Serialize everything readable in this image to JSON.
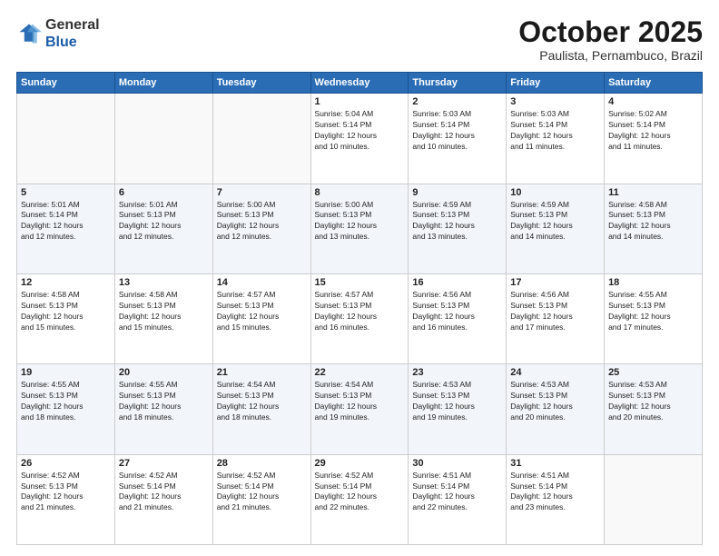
{
  "header": {
    "logo_line1": "General",
    "logo_line2": "Blue",
    "month_title": "October 2025",
    "location": "Paulista, Pernambuco, Brazil"
  },
  "weekdays": [
    "Sunday",
    "Monday",
    "Tuesday",
    "Wednesday",
    "Thursday",
    "Friday",
    "Saturday"
  ],
  "weeks": [
    [
      {
        "day": "",
        "info": ""
      },
      {
        "day": "",
        "info": ""
      },
      {
        "day": "",
        "info": ""
      },
      {
        "day": "1",
        "info": "Sunrise: 5:04 AM\nSunset: 5:14 PM\nDaylight: 12 hours\nand 10 minutes."
      },
      {
        "day": "2",
        "info": "Sunrise: 5:03 AM\nSunset: 5:14 PM\nDaylight: 12 hours\nand 10 minutes."
      },
      {
        "day": "3",
        "info": "Sunrise: 5:03 AM\nSunset: 5:14 PM\nDaylight: 12 hours\nand 11 minutes."
      },
      {
        "day": "4",
        "info": "Sunrise: 5:02 AM\nSunset: 5:14 PM\nDaylight: 12 hours\nand 11 minutes."
      }
    ],
    [
      {
        "day": "5",
        "info": "Sunrise: 5:01 AM\nSunset: 5:14 PM\nDaylight: 12 hours\nand 12 minutes."
      },
      {
        "day": "6",
        "info": "Sunrise: 5:01 AM\nSunset: 5:13 PM\nDaylight: 12 hours\nand 12 minutes."
      },
      {
        "day": "7",
        "info": "Sunrise: 5:00 AM\nSunset: 5:13 PM\nDaylight: 12 hours\nand 12 minutes."
      },
      {
        "day": "8",
        "info": "Sunrise: 5:00 AM\nSunset: 5:13 PM\nDaylight: 12 hours\nand 13 minutes."
      },
      {
        "day": "9",
        "info": "Sunrise: 4:59 AM\nSunset: 5:13 PM\nDaylight: 12 hours\nand 13 minutes."
      },
      {
        "day": "10",
        "info": "Sunrise: 4:59 AM\nSunset: 5:13 PM\nDaylight: 12 hours\nand 14 minutes."
      },
      {
        "day": "11",
        "info": "Sunrise: 4:58 AM\nSunset: 5:13 PM\nDaylight: 12 hours\nand 14 minutes."
      }
    ],
    [
      {
        "day": "12",
        "info": "Sunrise: 4:58 AM\nSunset: 5:13 PM\nDaylight: 12 hours\nand 15 minutes."
      },
      {
        "day": "13",
        "info": "Sunrise: 4:58 AM\nSunset: 5:13 PM\nDaylight: 12 hours\nand 15 minutes."
      },
      {
        "day": "14",
        "info": "Sunrise: 4:57 AM\nSunset: 5:13 PM\nDaylight: 12 hours\nand 15 minutes."
      },
      {
        "day": "15",
        "info": "Sunrise: 4:57 AM\nSunset: 5:13 PM\nDaylight: 12 hours\nand 16 minutes."
      },
      {
        "day": "16",
        "info": "Sunrise: 4:56 AM\nSunset: 5:13 PM\nDaylight: 12 hours\nand 16 minutes."
      },
      {
        "day": "17",
        "info": "Sunrise: 4:56 AM\nSunset: 5:13 PM\nDaylight: 12 hours\nand 17 minutes."
      },
      {
        "day": "18",
        "info": "Sunrise: 4:55 AM\nSunset: 5:13 PM\nDaylight: 12 hours\nand 17 minutes."
      }
    ],
    [
      {
        "day": "19",
        "info": "Sunrise: 4:55 AM\nSunset: 5:13 PM\nDaylight: 12 hours\nand 18 minutes."
      },
      {
        "day": "20",
        "info": "Sunrise: 4:55 AM\nSunset: 5:13 PM\nDaylight: 12 hours\nand 18 minutes."
      },
      {
        "day": "21",
        "info": "Sunrise: 4:54 AM\nSunset: 5:13 PM\nDaylight: 12 hours\nand 18 minutes."
      },
      {
        "day": "22",
        "info": "Sunrise: 4:54 AM\nSunset: 5:13 PM\nDaylight: 12 hours\nand 19 minutes."
      },
      {
        "day": "23",
        "info": "Sunrise: 4:53 AM\nSunset: 5:13 PM\nDaylight: 12 hours\nand 19 minutes."
      },
      {
        "day": "24",
        "info": "Sunrise: 4:53 AM\nSunset: 5:13 PM\nDaylight: 12 hours\nand 20 minutes."
      },
      {
        "day": "25",
        "info": "Sunrise: 4:53 AM\nSunset: 5:13 PM\nDaylight: 12 hours\nand 20 minutes."
      }
    ],
    [
      {
        "day": "26",
        "info": "Sunrise: 4:52 AM\nSunset: 5:13 PM\nDaylight: 12 hours\nand 21 minutes."
      },
      {
        "day": "27",
        "info": "Sunrise: 4:52 AM\nSunset: 5:14 PM\nDaylight: 12 hours\nand 21 minutes."
      },
      {
        "day": "28",
        "info": "Sunrise: 4:52 AM\nSunset: 5:14 PM\nDaylight: 12 hours\nand 21 minutes."
      },
      {
        "day": "29",
        "info": "Sunrise: 4:52 AM\nSunset: 5:14 PM\nDaylight: 12 hours\nand 22 minutes."
      },
      {
        "day": "30",
        "info": "Sunrise: 4:51 AM\nSunset: 5:14 PM\nDaylight: 12 hours\nand 22 minutes."
      },
      {
        "day": "31",
        "info": "Sunrise: 4:51 AM\nSunset: 5:14 PM\nDaylight: 12 hours\nand 23 minutes."
      },
      {
        "day": "",
        "info": ""
      }
    ]
  ]
}
